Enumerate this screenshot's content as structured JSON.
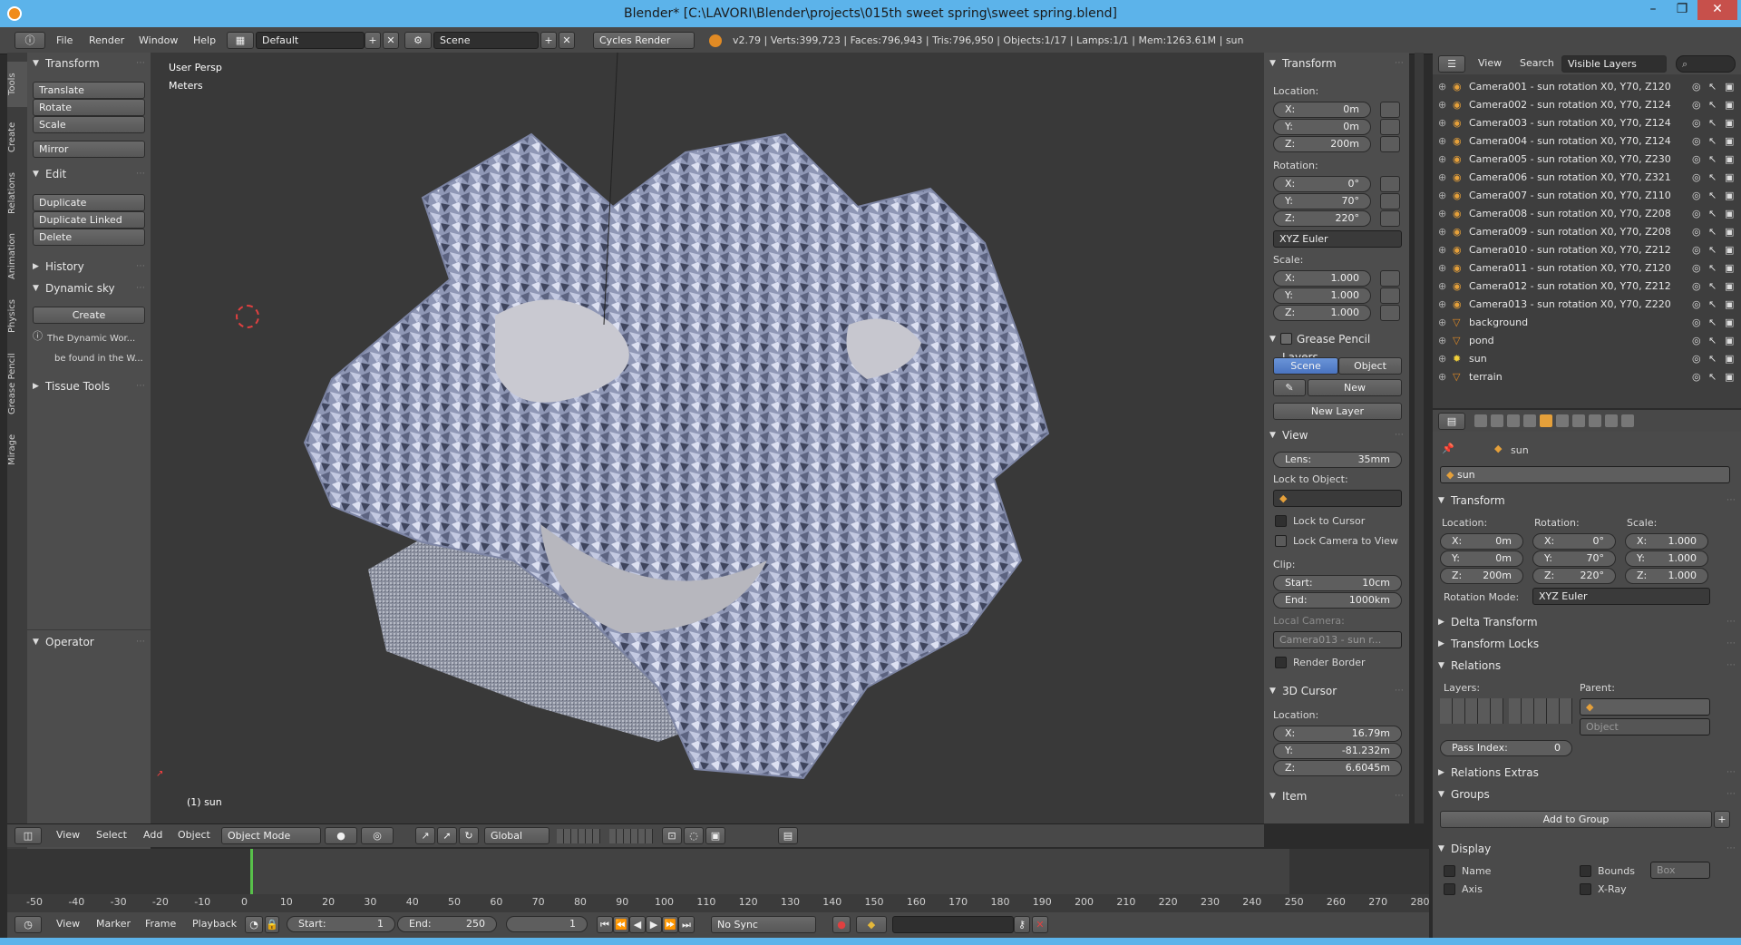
{
  "window": {
    "title": "Blender* [C:\\LAVORI\\Blender\\projects\\015th sweet spring\\sweet spring.blend]",
    "minimize": "–",
    "maximize": "❐",
    "close": "✕"
  },
  "topbar": {
    "menus": [
      "File",
      "Render",
      "Window",
      "Help"
    ],
    "screen_layout": "Default",
    "scene": "Scene",
    "engine": "Cycles Render",
    "stats": "v2.79 | Verts:399,723 | Faces:796,943 | Tris:796,950 | Objects:1/17 | Lamps:1/1 | Mem:1263.61M | sun"
  },
  "left_tabs": [
    "Tools",
    "Create",
    "Relations",
    "Animation",
    "Physics",
    "Grease Pencil",
    "Mirage"
  ],
  "toolshelf": {
    "transform_header": "Transform",
    "translate": "Translate",
    "rotate": "Rotate",
    "scale": "Scale",
    "mirror": "Mirror",
    "edit_header": "Edit",
    "duplicate": "Duplicate",
    "duplicate_linked": "Duplicate Linked",
    "delete": "Delete",
    "history_header": "History",
    "dynsky_header": "Dynamic sky",
    "create": "Create",
    "info_line1": "The Dynamic Wor...",
    "info_line2": "be found in the W...",
    "tissue_header": "Tissue Tools",
    "operator_header": "Operator"
  },
  "viewport": {
    "persp": "User Persp",
    "units": "Meters",
    "object_label": "(1) sun"
  },
  "npanel": {
    "transform": "Transform",
    "location": "Location:",
    "loc": {
      "x": "0m",
      "y": "0m",
      "z": "200m"
    },
    "rotation": "Rotation:",
    "rot": {
      "x": "0°",
      "y": "70°",
      "z": "220°"
    },
    "rot_mode": "XYZ Euler",
    "scale": "Scale:",
    "scl": {
      "x": "1.000",
      "y": "1.000",
      "z": "1.000"
    },
    "grease": "Grease Pencil Layers",
    "scene_tab": "Scene",
    "object_tab": "Object",
    "new": "New",
    "new_layer": "New Layer",
    "view": "View",
    "lens_k": "Lens:",
    "lens_v": "35mm",
    "lock_obj": "Lock to Object:",
    "lock_cursor": "Lock to Cursor",
    "lock_cam": "Lock Camera to View",
    "clip": "Clip:",
    "start_k": "Start:",
    "start_v": "10cm",
    "end_k": "End:",
    "end_v": "1000km",
    "local_cam": "Local Camera:",
    "local_cam_v": "Camera013 - sun r...",
    "render_border": "Render Border",
    "cursor3d": "3D Cursor",
    "cursor_loc": "Location:",
    "cur": {
      "x": "16.79m",
      "y": "-81.232m",
      "z": "6.6045m"
    },
    "item": "Item"
  },
  "outliner": {
    "view": "View",
    "search": "Search",
    "filter": "Visible Layers",
    "rows": [
      "Camera001 - sun rotation X0, Y70, Z120",
      "Camera002 - sun rotation X0, Y70, Z124",
      "Camera003 - sun rotation X0, Y70, Z124",
      "Camera004 - sun rotation X0, Y70, Z124",
      "Camera005 - sun rotation X0, Y70, Z230",
      "Camera006 - sun rotation X0, Y70, Z321",
      "Camera007 - sun rotation X0, Y70, Z110",
      "Camera008 - sun rotation X0, Y70, Z208",
      "Camera009 - sun rotation X0, Y70, Z208",
      "Camera010 - sun rotation X0, Y70, Z212",
      "Camera011 - sun rotation X0, Y70, Z120",
      "Camera012 - sun rotation X0, Y70, Z212",
      "Camera013 - sun rotation X0, Y70, Z220",
      "background",
      "pond",
      "sun",
      "terrain"
    ]
  },
  "props": {
    "crumb": "sun",
    "name": "sun",
    "transform": "Transform",
    "location": "Location:",
    "rotation": "Rotation:",
    "scale": "Scale:",
    "loc": {
      "x": "0m",
      "y": "0m",
      "z": "200m"
    },
    "rot": {
      "x": "0°",
      "y": "70°",
      "z": "220°"
    },
    "scl": {
      "x": "1.000",
      "y": "1.000",
      "z": "1.000"
    },
    "rot_mode_k": "Rotation Mode:",
    "rot_mode_v": "XYZ Euler",
    "delta": "Delta Transform",
    "locks": "Transform Locks",
    "relations": "Relations",
    "layers": "Layers:",
    "parent": "Parent:",
    "parent_type": "Object",
    "pass_index_k": "Pass Index:",
    "pass_index_v": "0",
    "rel_extras": "Relations Extras",
    "groups": "Groups",
    "add_group": "Add to Group",
    "display": "Display",
    "name_chk": "Name",
    "bounds": "Bounds",
    "box": "Box",
    "axis": "Axis",
    "xray": "X-Ray"
  },
  "viewbar": {
    "view": "View",
    "select": "Select",
    "add": "Add",
    "object": "Object",
    "mode": "Object Mode",
    "orient": "Global"
  },
  "timeline": {
    "ticks": [
      "-50",
      "-40",
      "-30",
      "-20",
      "-10",
      "0",
      "10",
      "20",
      "30",
      "40",
      "50",
      "60",
      "70",
      "80",
      "90",
      "100",
      "110",
      "120",
      "130",
      "140",
      "150",
      "160",
      "170",
      "180",
      "190",
      "200",
      "210",
      "220",
      "230",
      "240",
      "250",
      "260",
      "270",
      "280"
    ],
    "view": "View",
    "marker": "Marker",
    "frame": "Frame",
    "playback": "Playback",
    "start_k": "Start:",
    "start_v": "1",
    "end_k": "End:",
    "end_v": "250",
    "current": "1",
    "sync": "No Sync"
  }
}
